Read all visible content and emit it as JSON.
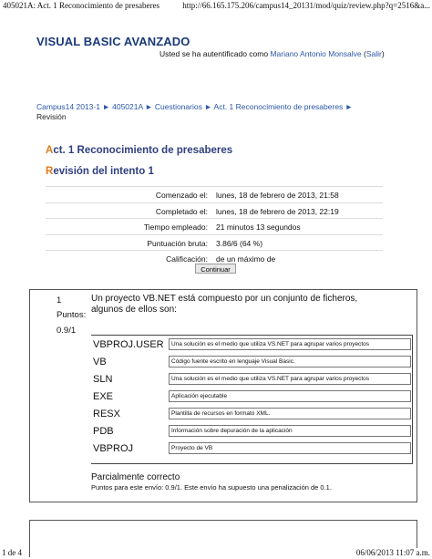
{
  "print_header": {
    "title": "405021A: Act. 1 Reconocimiento de presaberes",
    "url": "http://66.165.175.206/campus14_20131/mod/quiz/review.php?q=2516&a..."
  },
  "site": {
    "title": "VISUAL BASIC AVANZADO"
  },
  "login": {
    "prefix": "Usted se ha autentificado como",
    "user": "Mariano Antonio Monsalve",
    "logout": "Salir"
  },
  "breadcrumb": {
    "items": [
      "Campus14 2013-1",
      "405021A",
      "Cuestionarios",
      "Act. 1 Reconocimiento de presaberes"
    ],
    "separator": "►",
    "current": "Revisión"
  },
  "headings": {
    "activity": "Act. 1 Reconocimiento de presaberes",
    "review": "Revisión del intento 1"
  },
  "summary": [
    {
      "label": "Comenzado el:",
      "value": "lunes, 18 de febrero de 2013, 21:58"
    },
    {
      "label": "Completado el:",
      "value": "lunes, 18 de febrero de 2013, 22:19"
    },
    {
      "label": "Tiempo empleado:",
      "value": "21 minutos 13 segundos"
    },
    {
      "label": "Puntuación bruta:",
      "value": "3.86/6 (64 %)"
    },
    {
      "label": "Calificación:",
      "value": "de un máximo de"
    }
  ],
  "continue_label": "Continuar",
  "question": {
    "number": "1",
    "points_label": "Puntos:",
    "points": "0.9/1",
    "text": "Un proyecto VB.NET está compuesto por un conjunto de ficheros, algunos de ellos son:",
    "answers": [
      {
        "term": "VBPROJ.USER",
        "answer": "Una solución es el medio que utiliza VS.NET para agrupar varios proyectos"
      },
      {
        "term": "VB",
        "answer": "Código fuente escrito en lenguaje Visual Basic."
      },
      {
        "term": "SLN",
        "answer": "Una solución es el medio que utiliza VS.NET para agrupar varios proyectos"
      },
      {
        "term": "EXE",
        "answer": "Aplicación ejecutable"
      },
      {
        "term": "RESX",
        "answer": "Plantilla de recursos en formato XML."
      },
      {
        "term": "PDB",
        "answer": "Información sobre depuración de la aplicación"
      },
      {
        "term": "VBPROJ",
        "answer": "Proyecto de VB"
      }
    ],
    "state": "Parcialmente correcto",
    "grading": "Puntos para este envío: 0.9/1. Este envío ha supuesto una penalización de 0.1."
  },
  "print_footer": {
    "page": "1 de 4",
    "date": "06/06/2013 11:07 a.m."
  }
}
